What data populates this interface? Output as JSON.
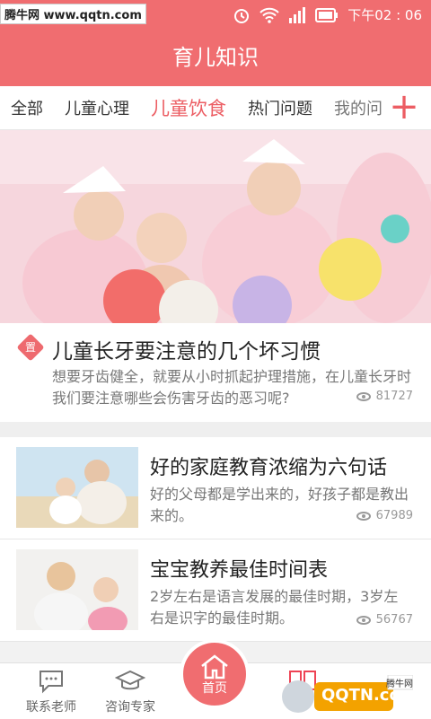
{
  "status_bar": {
    "watermark": "腾牛网 www.qqtn.com",
    "time": "下午02 : 06"
  },
  "app_bar": {
    "title": "育儿知识"
  },
  "tabs": [
    {
      "label": "全部"
    },
    {
      "label": "儿童心理"
    },
    {
      "label": "儿童饮食",
      "active": true
    },
    {
      "label": "热门问题"
    },
    {
      "label": "我的问"
    }
  ],
  "featured": {
    "badge": "置",
    "title": "儿童长牙要注意的几个坏习惯",
    "desc": "想要牙齿健全，就要从小时抓起护理措施，在儿童长牙时我们要注意哪些会伤害牙齿的恶习呢?",
    "views": "81727"
  },
  "articles": [
    {
      "title": "好的家庭教育浓缩为六句话",
      "desc": "好的父母都是学出来的，好孩子都是教出来的。",
      "views": "67989"
    },
    {
      "title": "宝宝教养最佳时间表",
      "desc": "2岁左右是语言发展的最佳时期，3岁左右是识字的最佳时期。",
      "views": "56767"
    }
  ],
  "bottom_nav": {
    "contact": "联系老师",
    "consult": "咨询专家",
    "home": "首页"
  },
  "watermark_br": {
    "logo": "QQTN.com",
    "small": "腾牛网"
  },
  "colors": {
    "accent": "#f06d70",
    "active_tab": "#ec5d63"
  }
}
